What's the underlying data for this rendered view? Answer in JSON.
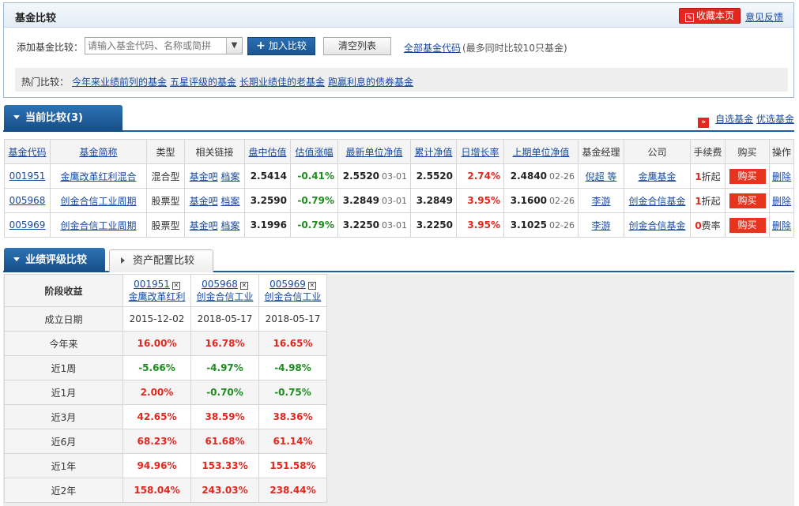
{
  "top": {
    "title": "基金比较",
    "favorite_label": "收藏本页",
    "feedback_label": "意见反馈",
    "add_label": "添加基金比较：",
    "input_placeholder": "请输入基金代码、名称或简拼",
    "add_button": "加入比较",
    "clear_button": "清空列表",
    "all_codes_link": "全部基金代码",
    "all_codes_note": "(最多同时比较10只基金)",
    "hot_label": "热门比较：",
    "hot_links": [
      "今年来业绩前列的基金",
      "五星评级的基金",
      "长期业绩佳的老基金",
      "跑赢利息的债券基金"
    ]
  },
  "current": {
    "tab_label": "当前比较(3)",
    "link_optional": "自选基金",
    "link_preferred": "优选基金",
    "columns": [
      "基金代码",
      "基金简称",
      "类型",
      "相关链接",
      "盘中估值",
      "估值涨幅",
      "最新单位净值",
      "累计净值",
      "日增长率",
      "上期单位净值",
      "基金经理",
      "公司",
      "手续费",
      "购买",
      "操作"
    ],
    "rows": [
      {
        "code": "001951",
        "name": "金鹰改革红利混合",
        "type": "混合型",
        "link1": "基金吧",
        "link2": "档案",
        "est": "2.5414",
        "est_chg": "-0.41%",
        "nav": "2.5520",
        "nav_date": "03-01",
        "acc": "2.5520",
        "day": "2.74%",
        "prev": "2.4840",
        "prev_date": "02-26",
        "manager": "倪超 等",
        "company": "金鹰基金",
        "fee_num": "1",
        "fee_text": "折起",
        "buy": "购买",
        "op": "删除"
      },
      {
        "code": "005968",
        "name": "创金合信工业周期",
        "type": "股票型",
        "link1": "基金吧",
        "link2": "档案",
        "est": "3.2590",
        "est_chg": "-0.79%",
        "nav": "3.2849",
        "nav_date": "03-01",
        "acc": "3.2849",
        "day": "3.95%",
        "prev": "3.1600",
        "prev_date": "02-26",
        "manager": "李游",
        "company": "创金合信基金",
        "fee_num": "1",
        "fee_text": "折起",
        "buy": "购买",
        "op": "删除"
      },
      {
        "code": "005969",
        "name": "创金合信工业周期",
        "type": "股票型",
        "link1": "基金吧",
        "link2": "档案",
        "est": "3.1996",
        "est_chg": "-0.79%",
        "nav": "3.2250",
        "nav_date": "03-01",
        "acc": "3.2250",
        "day": "3.95%",
        "prev": "3.1025",
        "prev_date": "02-26",
        "manager": "李游",
        "company": "创金合信基金",
        "fee_num": "0",
        "fee_text": "费率",
        "buy": "购买",
        "op": "删除"
      }
    ]
  },
  "perf": {
    "tab_active": "业绩评级比较",
    "tab_other": "资产配置比较",
    "row_header": "阶段收益",
    "funds": [
      {
        "code": "001951",
        "name": "金鹰改革红利"
      },
      {
        "code": "005968",
        "name": "创金合信工业"
      },
      {
        "code": "005969",
        "name": "创金合信工业"
      }
    ],
    "rows": [
      {
        "label": "成立日期",
        "values": [
          "2015-12-02",
          "2018-05-17",
          "2018-05-17"
        ],
        "kind": "plain"
      },
      {
        "label": "今年来",
        "values": [
          "16.00%",
          "16.78%",
          "16.65%"
        ],
        "kind": "pos"
      },
      {
        "label": "近1周",
        "values": [
          "-5.66%",
          "-4.97%",
          "-4.98%"
        ],
        "kind": "neg"
      },
      {
        "label": "近1月",
        "values": [
          "2.00%",
          "-0.70%",
          "-0.75%"
        ],
        "kind": "mixed"
      },
      {
        "label": "近3月",
        "values": [
          "42.65%",
          "38.59%",
          "38.36%"
        ],
        "kind": "pos"
      },
      {
        "label": "近6月",
        "values": [
          "68.23%",
          "61.68%",
          "61.14%"
        ],
        "kind": "pos"
      },
      {
        "label": "近1年",
        "values": [
          "94.96%",
          "153.33%",
          "151.58%"
        ],
        "kind": "pos"
      },
      {
        "label": "近2年",
        "values": [
          "158.04%",
          "243.03%",
          "238.44%"
        ],
        "kind": "pos"
      }
    ]
  },
  "colors": {
    "accent_blue": "#1d5f9e",
    "up_red": "#e3271f",
    "down_green": "#1f8a1f",
    "link": "#1a4aa0"
  }
}
